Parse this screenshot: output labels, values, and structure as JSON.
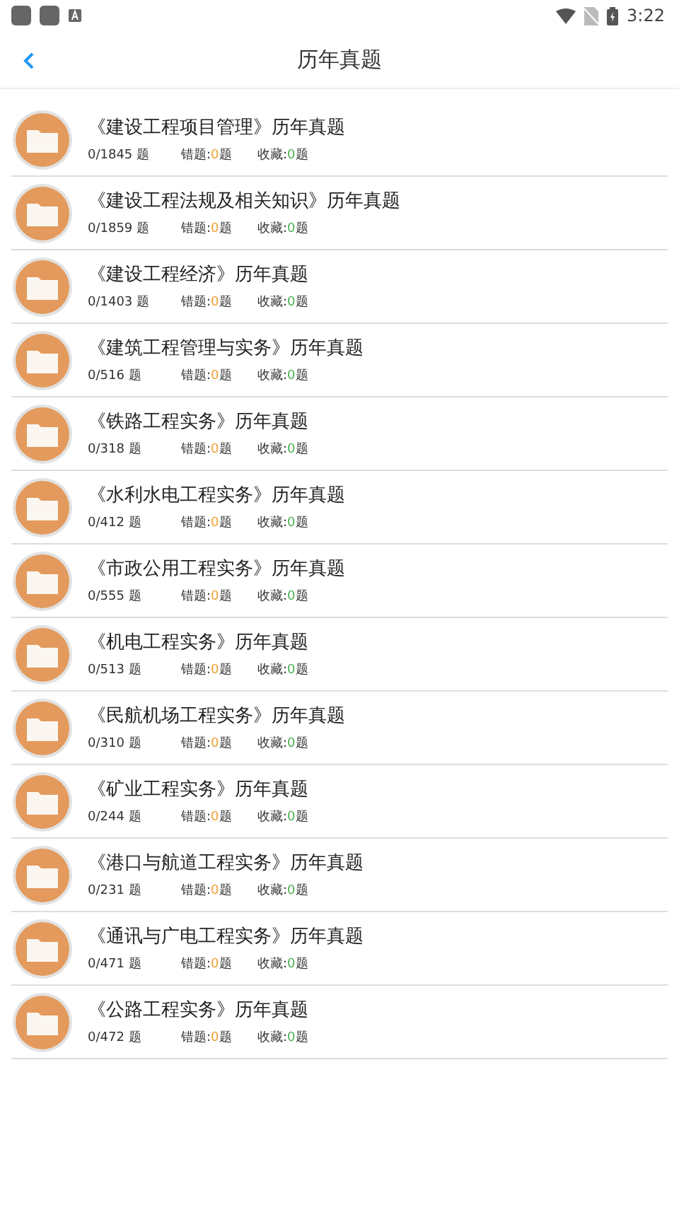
{
  "status_bar": {
    "time": "3:22"
  },
  "header": {
    "title": "历年真题"
  },
  "items": [
    {
      "title": "《建设工程项目管理》历年真题",
      "progress": "0/1845 题",
      "wrong": {
        "label": "错题:",
        "count": "0",
        "unit": "题"
      },
      "favorites": {
        "label": "收藏:",
        "count": "0",
        "unit": "题"
      }
    },
    {
      "title": "《建设工程法规及相关知识》历年真题",
      "progress": "0/1859 题",
      "wrong": {
        "label": "错题:",
        "count": "0",
        "unit": "题"
      },
      "favorites": {
        "label": "收藏:",
        "count": "0",
        "unit": "题"
      }
    },
    {
      "title": "《建设工程经济》历年真题",
      "progress": "0/1403 题",
      "wrong": {
        "label": "错题:",
        "count": "0",
        "unit": "题"
      },
      "favorites": {
        "label": "收藏:",
        "count": "0",
        "unit": "题"
      }
    },
    {
      "title": "《建筑工程管理与实务》历年真题",
      "progress": "0/516 题",
      "wrong": {
        "label": "错题:",
        "count": "0",
        "unit": "题"
      },
      "favorites": {
        "label": "收藏:",
        "count": "0",
        "unit": "题"
      }
    },
    {
      "title": "《铁路工程实务》历年真题",
      "progress": "0/318 题",
      "wrong": {
        "label": "错题:",
        "count": "0",
        "unit": "题"
      },
      "favorites": {
        "label": "收藏:",
        "count": "0",
        "unit": "题"
      }
    },
    {
      "title": "《水利水电工程实务》历年真题",
      "progress": "0/412 题",
      "wrong": {
        "label": "错题:",
        "count": "0",
        "unit": "题"
      },
      "favorites": {
        "label": "收藏:",
        "count": "0",
        "unit": "题"
      }
    },
    {
      "title": "《市政公用工程实务》历年真题",
      "progress": "0/555 题",
      "wrong": {
        "label": "错题:",
        "count": "0",
        "unit": "题"
      },
      "favorites": {
        "label": "收藏:",
        "count": "0",
        "unit": "题"
      }
    },
    {
      "title": "《机电工程实务》历年真题",
      "progress": "0/513 题",
      "wrong": {
        "label": "错题:",
        "count": "0",
        "unit": "题"
      },
      "favorites": {
        "label": "收藏:",
        "count": "0",
        "unit": "题"
      }
    },
    {
      "title": "《民航机场工程实务》历年真题",
      "progress": "0/310 题",
      "wrong": {
        "label": "错题:",
        "count": "0",
        "unit": "题"
      },
      "favorites": {
        "label": "收藏:",
        "count": "0",
        "unit": "题"
      }
    },
    {
      "title": "《矿业工程实务》历年真题",
      "progress": "0/244 题",
      "wrong": {
        "label": "错题:",
        "count": "0",
        "unit": "题"
      },
      "favorites": {
        "label": "收藏:",
        "count": "0",
        "unit": "题"
      }
    },
    {
      "title": "《港口与航道工程实务》历年真题",
      "progress": "0/231 题",
      "wrong": {
        "label": "错题:",
        "count": "0",
        "unit": "题"
      },
      "favorites": {
        "label": "收藏:",
        "count": "0",
        "unit": "题"
      }
    },
    {
      "title": "《通讯与广电工程实务》历年真题",
      "progress": "0/471 题",
      "wrong": {
        "label": "错题:",
        "count": "0",
        "unit": "题"
      },
      "favorites": {
        "label": "收藏:",
        "count": "0",
        "unit": "题"
      }
    },
    {
      "title": "《公路工程实务》历年真题",
      "progress": "0/472 题",
      "wrong": {
        "label": "错题:",
        "count": "0",
        "unit": "题"
      },
      "favorites": {
        "label": "收藏:",
        "count": "0",
        "unit": "题"
      }
    }
  ]
}
